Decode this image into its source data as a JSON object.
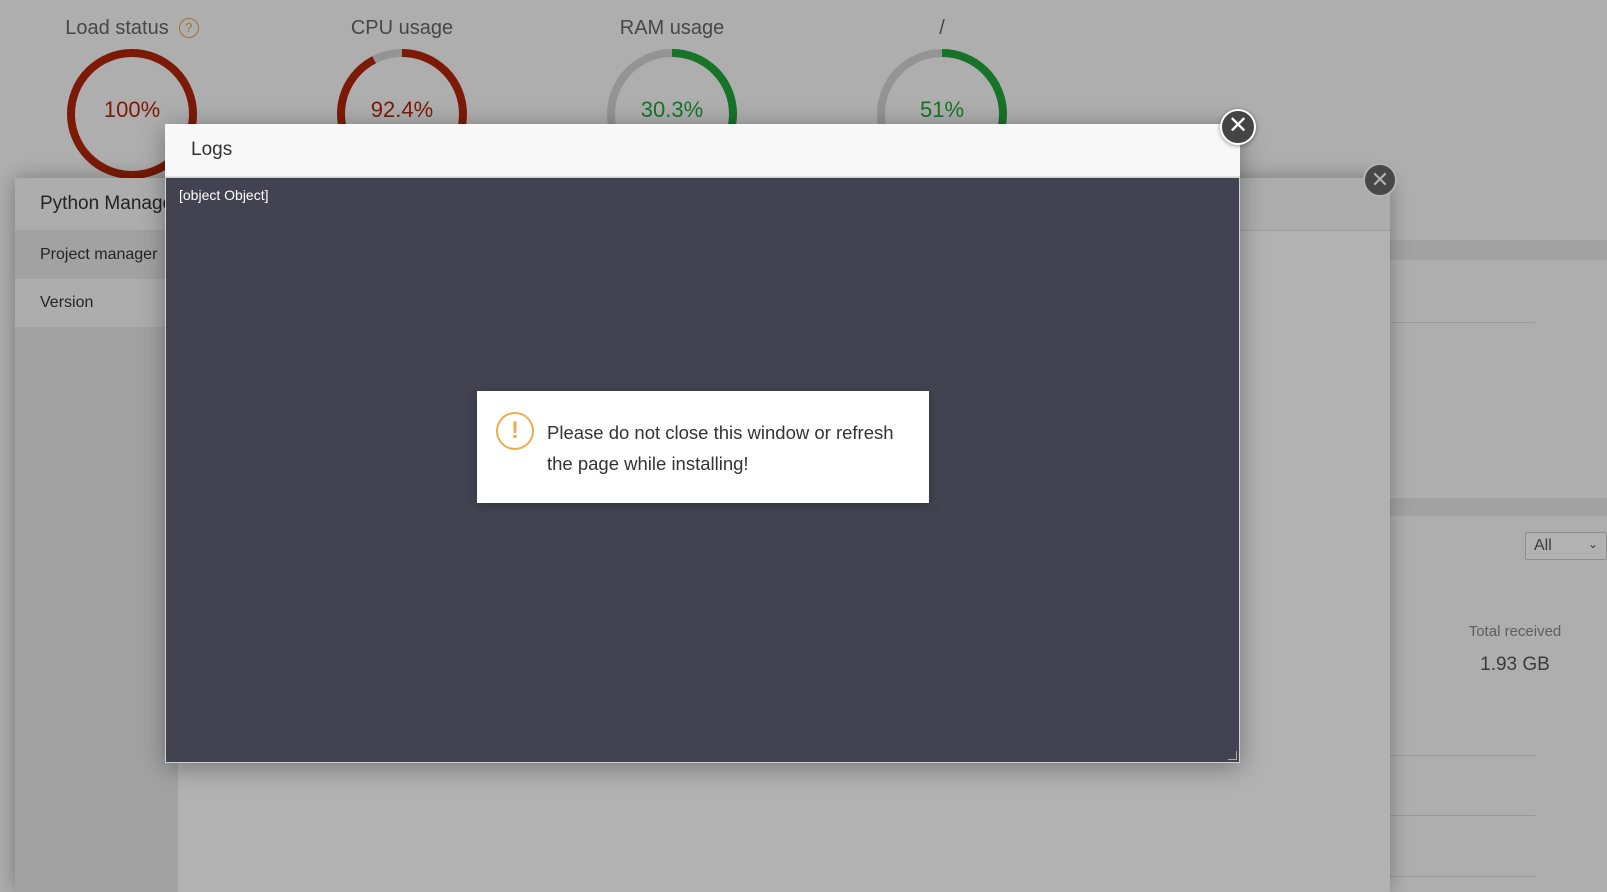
{
  "dashboard": {
    "gauges": [
      {
        "title": "Load status",
        "value": "100%",
        "fraction": 1.0,
        "color": "#b3260b",
        "help": "?"
      },
      {
        "title": "CPU usage",
        "value": "92.4%",
        "fraction": 0.924,
        "color": "#b3260b"
      },
      {
        "title": "RAM usage",
        "value": "30.3%",
        "fraction": 0.303,
        "color": "#20a53a"
      },
      {
        "title": "/",
        "value": "51%",
        "fraction": 0.51,
        "color": "#20a53a"
      }
    ],
    "select_value": "All",
    "total_received_label": "Total received",
    "total_received_value": "1.93 GB"
  },
  "python_manager": {
    "title": "Python Manager",
    "nav": [
      {
        "label": "Project manager"
      },
      {
        "label": "Version"
      }
    ],
    "close_glyph": "✕"
  },
  "logs_modal": {
    "title": "Logs",
    "content": "[object Object]",
    "close_glyph": "✕"
  },
  "toast": {
    "icon_glyph": "!",
    "message": "Please do not close this window or refresh the page while installing!"
  },
  "colors": {
    "danger": "#b3260b",
    "success": "#20a53a",
    "warning": "#f0ad4e",
    "log_bg": "#434250"
  }
}
